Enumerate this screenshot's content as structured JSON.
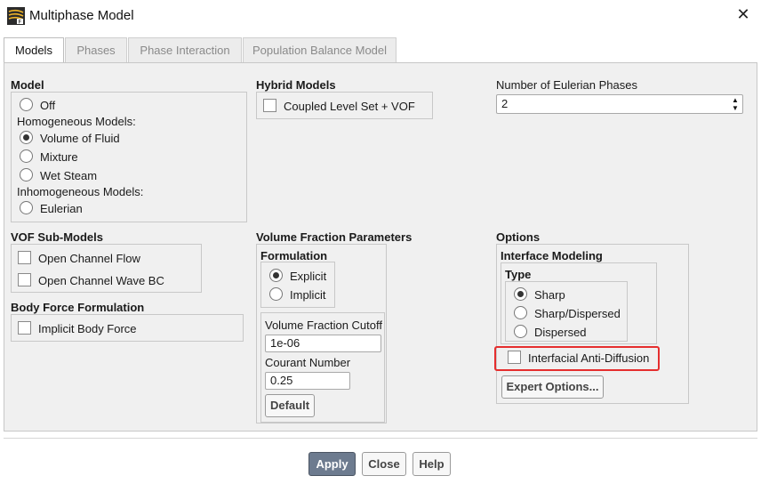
{
  "window": {
    "title": "Multiphase Model"
  },
  "tabs": [
    {
      "label": "Models"
    },
    {
      "label": "Phases"
    },
    {
      "label": "Phase Interaction"
    },
    {
      "label": "Population Balance Model"
    }
  ],
  "model": {
    "title": "Model",
    "off": "Off",
    "homogeneous_header": "Homogeneous Models:",
    "vof": "Volume of Fluid",
    "mixture": "Mixture",
    "wet_steam": "Wet Steam",
    "inhomogeneous_header": "Inhomogeneous Models:",
    "eulerian": "Eulerian",
    "selected": "Volume of Fluid"
  },
  "hybrid": {
    "title": "Hybrid Models",
    "coupled_level_set": "Coupled Level Set + VOF"
  },
  "eulerian_phases": {
    "label": "Number of Eulerian Phases",
    "value": "2"
  },
  "vof_submodels": {
    "title": "VOF Sub-Models",
    "open_channel_flow": "Open Channel Flow",
    "open_channel_wave_bc": "Open Channel Wave BC"
  },
  "body_force": {
    "title": "Body Force Formulation",
    "implicit_body_force": "Implicit Body Force"
  },
  "vfp": {
    "title": "Volume Fraction Parameters",
    "formulation_title": "Formulation",
    "explicit": "Explicit",
    "implicit": "Implicit",
    "selected": "Explicit",
    "cutoff_label": "Volume Fraction Cutoff",
    "cutoff_value": "1e-06",
    "courant_label": "Courant Number",
    "courant_value": "0.25",
    "default_button": "Default"
  },
  "options": {
    "title": "Options",
    "interface_modeling_title": "Interface Modeling",
    "type_title": "Type",
    "sharp": "Sharp",
    "sharp_dispersed": "Sharp/Dispersed",
    "dispersed": "Dispersed",
    "selected": "Sharp",
    "anti_diffusion": "Interfacial Anti-Diffusion",
    "expert_button": "Expert Options..."
  },
  "footer": {
    "apply": "Apply",
    "close": "Close",
    "help": "Help"
  },
  "colors": {
    "highlight": "#e52e2e",
    "apply_bg": "#6d7b8f"
  }
}
